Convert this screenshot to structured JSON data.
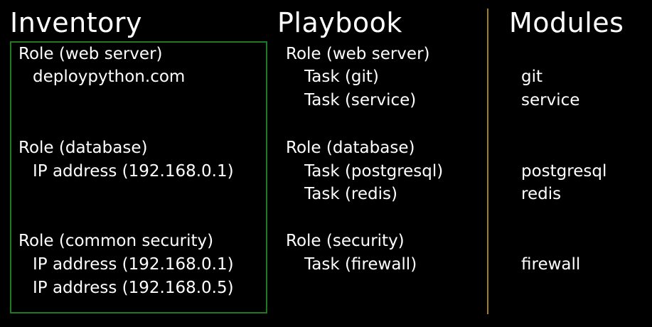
{
  "headings": {
    "inventory": "Inventory",
    "playbook": "Playbook",
    "modules": "Modules"
  },
  "colors": {
    "background": "#000000",
    "text": "#ffffff",
    "inventory_border": "#1f7a1f",
    "divider": "#a08020"
  },
  "inventory": {
    "groups": [
      {
        "role": "Role (web server)",
        "hosts": [
          "deploypython.com"
        ]
      },
      {
        "role": "Role (database)",
        "hosts": [
          "IP address (192.168.0.1)"
        ]
      },
      {
        "role": "Role (common security)",
        "hosts": [
          "IP address (192.168.0.1)",
          "IP address (192.168.0.5)"
        ]
      }
    ]
  },
  "playbook": {
    "roles": [
      {
        "role": "Role (web server)",
        "tasks": [
          "Task (git)",
          "Task (service)"
        ]
      },
      {
        "role": "Role (database)",
        "tasks": [
          "Task (postgresql)",
          "Task (redis)"
        ]
      },
      {
        "role": "Role (security)",
        "tasks": [
          "Task (firewall)"
        ]
      }
    ]
  },
  "modules": {
    "items": [
      "git",
      "service",
      "postgresql",
      "redis",
      "firewall"
    ]
  }
}
